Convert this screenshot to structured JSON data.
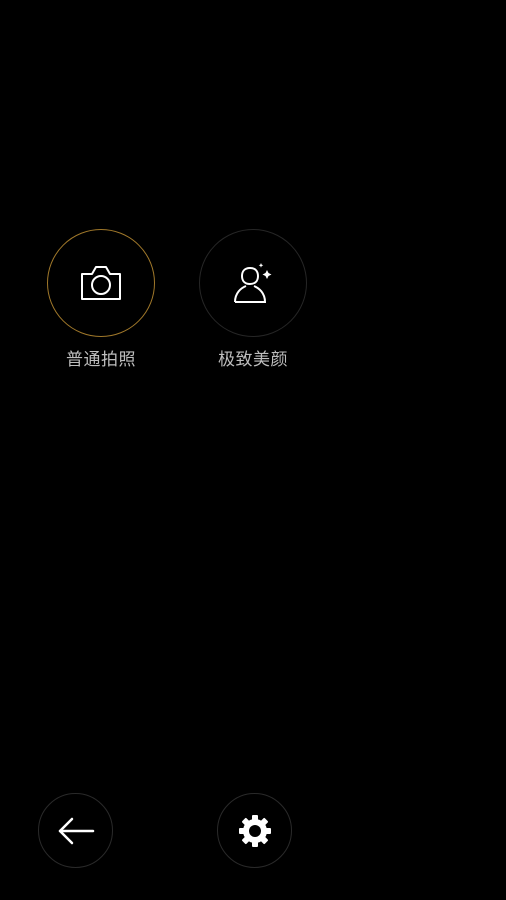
{
  "modes": [
    {
      "label": "普通拍照",
      "icon": "camera-icon",
      "selected": true
    },
    {
      "label": "极致美颜",
      "icon": "beauty-portrait-icon",
      "selected": false
    }
  ],
  "bottom_bar": {
    "back_icon": "arrow-left-icon",
    "settings_icon": "gear-icon"
  },
  "colors": {
    "background": "#000000",
    "selected_ring": "#a0782a",
    "label": "#bdbdbd",
    "icon": "#ffffff"
  }
}
